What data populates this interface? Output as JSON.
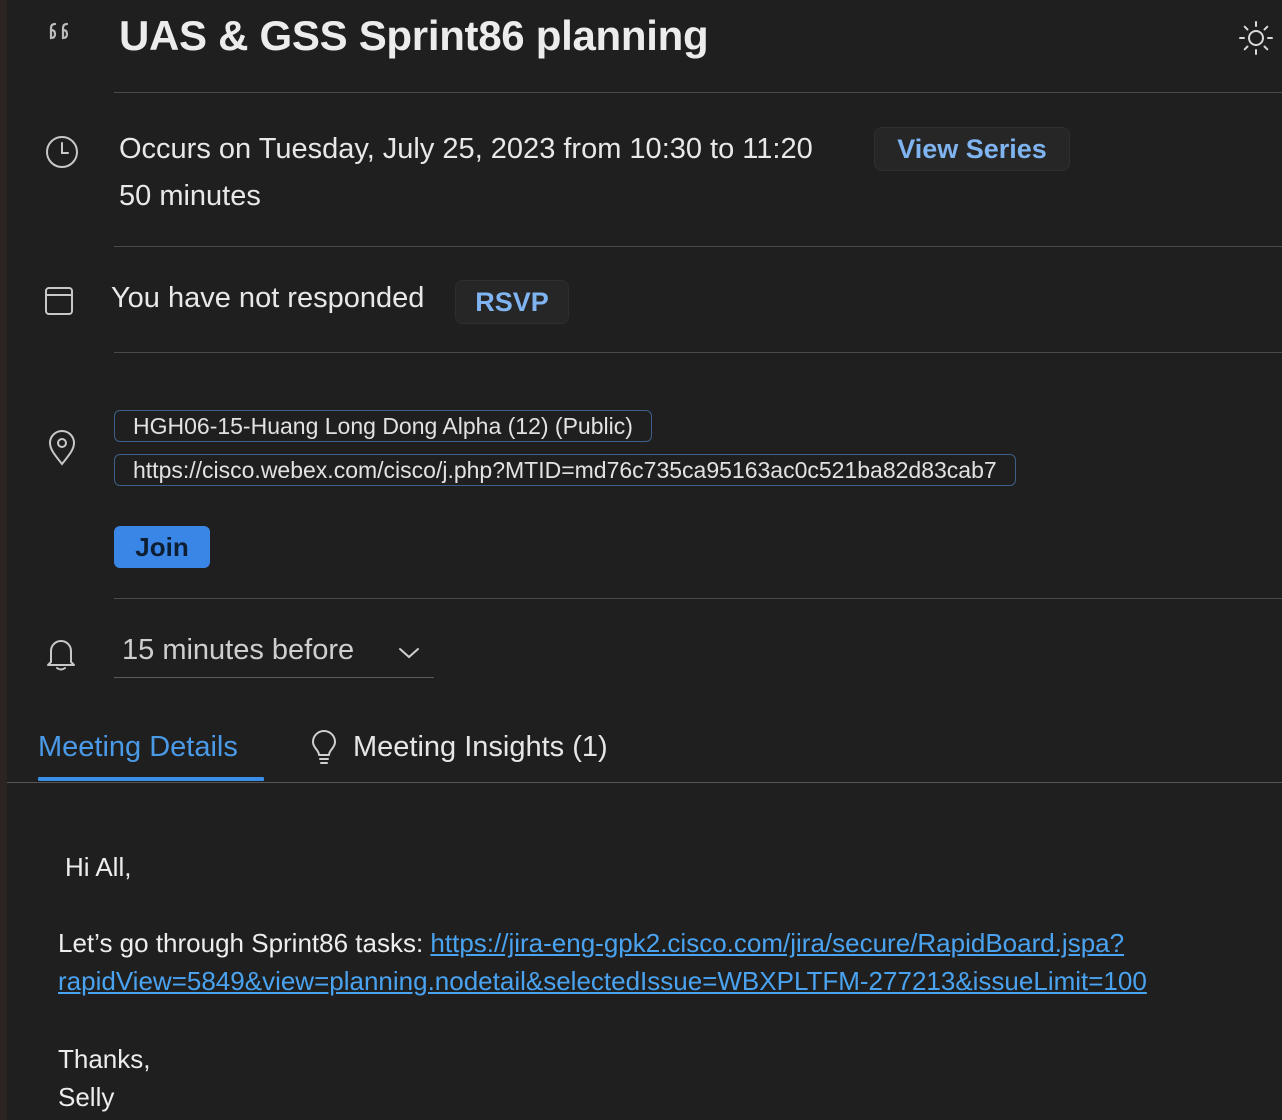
{
  "meeting": {
    "title": "UAS & GSS Sprint86 planning",
    "occurrence": "Occurs on Tuesday, July 25, 2023 from 10:30 to 11:20",
    "duration": "50 minutes",
    "view_series_label": "View Series",
    "response_status": "You have not responded",
    "rsvp_label": "RSVP",
    "location": "HGH06-15-Huang Long Dong Alpha (12) (Public)",
    "meeting_link": "https://cisco.webex.com/cisco/j.php?MTID=md76c735ca95163ac0c521ba82d83cab7",
    "join_label": "Join",
    "reminder": "15 minutes before"
  },
  "tabs": {
    "details_label": "Meeting Details",
    "insights_label": "Meeting Insights (1)",
    "active": "details"
  },
  "body": {
    "greeting": "Hi All,",
    "line_prefix": "Let’s go through Sprint86 tasks: ",
    "link_line1": "https://jira-eng-gpk2.cisco.com/jira/secure/RapidBoard.jspa?",
    "link_line2": "rapidView=5849&view=planning.nodetail&selectedIssue=WBXPLTFM-277213&issueLimit=100",
    "thanks": "Thanks,",
    "signature": "Selly"
  },
  "icons": {
    "title": "quote-icon",
    "theme": "sun-icon",
    "time": "clock-icon",
    "response": "calendar-icon",
    "location": "location-pin-icon",
    "reminder": "bell-icon",
    "dropdown": "chevron-down-icon",
    "insights": "lightbulb-icon"
  },
  "colors": {
    "background": "#1f1f1f",
    "accent": "#3a86e6",
    "link": "#4aa3f0",
    "button_text": "#7fb4f0"
  }
}
